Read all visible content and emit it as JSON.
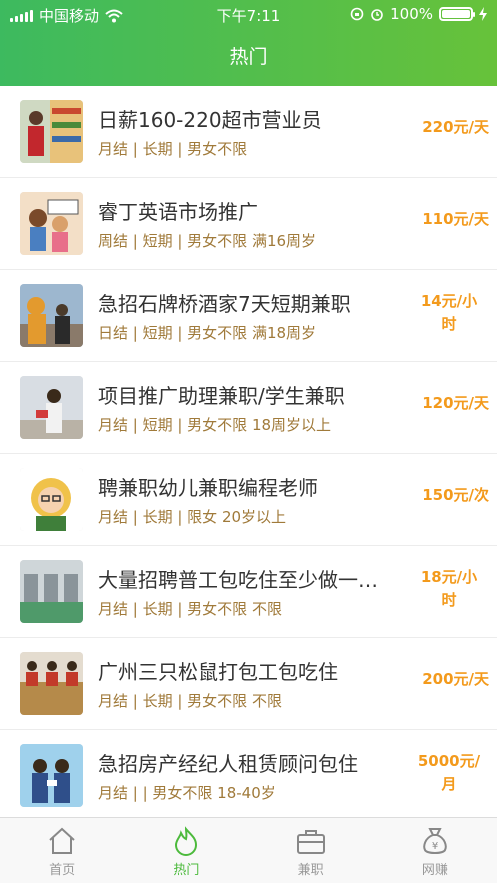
{
  "status_bar": {
    "carrier": "中国移动",
    "time": "下午7:11",
    "battery": "100%"
  },
  "page_title": "热门",
  "jobs": [
    {
      "title": "日薪160-220超市营业员",
      "meta": "月结 | 长期 | 男女不限",
      "pay": "220元/天"
    },
    {
      "title": "睿丁英语市场推广",
      "meta": "周结 | 短期 | 男女不限 满16周岁",
      "pay": "110元/天"
    },
    {
      "title": "急招石牌桥酒家7天短期兼职",
      "meta": "日结 | 短期 | 男女不限 满18周岁",
      "pay_line1": "14元/小",
      "pay_line2": "时"
    },
    {
      "title": "项目推广助理兼职/学生兼职",
      "meta": "月结 | 短期 | 男女不限 18周岁以上",
      "pay": "120元/天"
    },
    {
      "title": "聘兼职幼儿兼职编程老师",
      "meta": "月结 | 长期 | 限女 20岁以上",
      "pay": "150元/次"
    },
    {
      "title": "大量招聘普工包吃住至少做一…",
      "meta": "月结 | 长期 | 男女不限 不限",
      "pay_line1": "18元/小",
      "pay_line2": "时"
    },
    {
      "title": "广州三只松鼠打包工包吃住",
      "meta": "月结 | 长期 | 男女不限 不限",
      "pay": "200元/天"
    },
    {
      "title": "急招房产经纪人租赁顾问包住",
      "meta": "月结 |  | 男女不限 18-40岁",
      "pay_line1": "5000元/",
      "pay_line2": "月"
    }
  ],
  "tabs": [
    {
      "label": "首页",
      "icon": "home-icon"
    },
    {
      "label": "热门",
      "icon": "flame-icon",
      "active": true
    },
    {
      "label": "兼职",
      "icon": "briefcase-icon"
    },
    {
      "label": "网赚",
      "icon": "money-bag-icon"
    }
  ],
  "colors": {
    "header_green": "#4cba3c",
    "pay_orange": "#f39a1c",
    "meta_brown": "#a07a3a"
  }
}
